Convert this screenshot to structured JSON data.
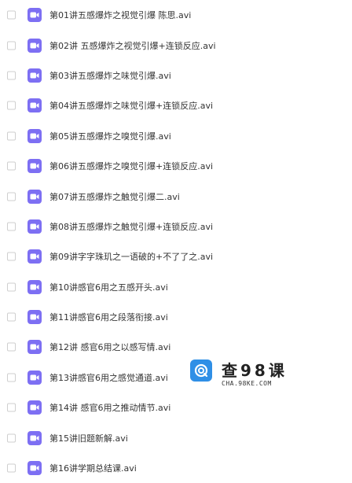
{
  "files": [
    {
      "name": "第01讲五感爆炸之视觉引爆 陈思.avi",
      "icon": "video-file-icon"
    },
    {
      "name": "第02讲 五感爆炸之视觉引爆+连锁反应.avi",
      "icon": "video-file-icon"
    },
    {
      "name": "第03讲五感爆炸之味觉引爆.avi",
      "icon": "video-file-icon"
    },
    {
      "name": "第04讲五感爆炸之味觉引爆+连锁反应.avi",
      "icon": "video-file-icon"
    },
    {
      "name": "第05讲五感爆炸之嗅觉引爆.avi",
      "icon": "video-file-icon"
    },
    {
      "name": "第06讲五感爆炸之嗅觉引爆+连锁反应.avi",
      "icon": "video-file-icon"
    },
    {
      "name": "第07讲五感爆炸之触觉引爆二.avi",
      "icon": "video-file-icon"
    },
    {
      "name": "第08讲五感爆炸之触觉引爆+连锁反应.avi",
      "icon": "video-file-icon"
    },
    {
      "name": "第09讲字字珠玑之一语破的+不了了之.avi",
      "icon": "video-file-icon"
    },
    {
      "name": "第10讲感官6用之五感开头.avi",
      "icon": "video-file-icon"
    },
    {
      "name": "第11讲感官6用之段落衔接.avi",
      "icon": "video-file-icon"
    },
    {
      "name": "第12讲 感官6用之以感写情.avi",
      "icon": "video-file-icon"
    },
    {
      "name": "第13讲感官6用之感觉通道.avi",
      "icon": "video-file-icon"
    },
    {
      "name": "第14讲 感官6用之推动情节.avi",
      "icon": "video-file-icon"
    },
    {
      "name": "第15讲旧题新解.avi",
      "icon": "video-file-icon"
    },
    {
      "name": "第16讲学期总结课.avi",
      "icon": "video-file-icon"
    }
  ],
  "colors": {
    "icon_bg": "#7d6ff3",
    "text": "#333333",
    "checkbox_border": "#cfcfcf"
  },
  "watermark": {
    "title": "查98课",
    "url": "CHA.98KE.COM"
  }
}
